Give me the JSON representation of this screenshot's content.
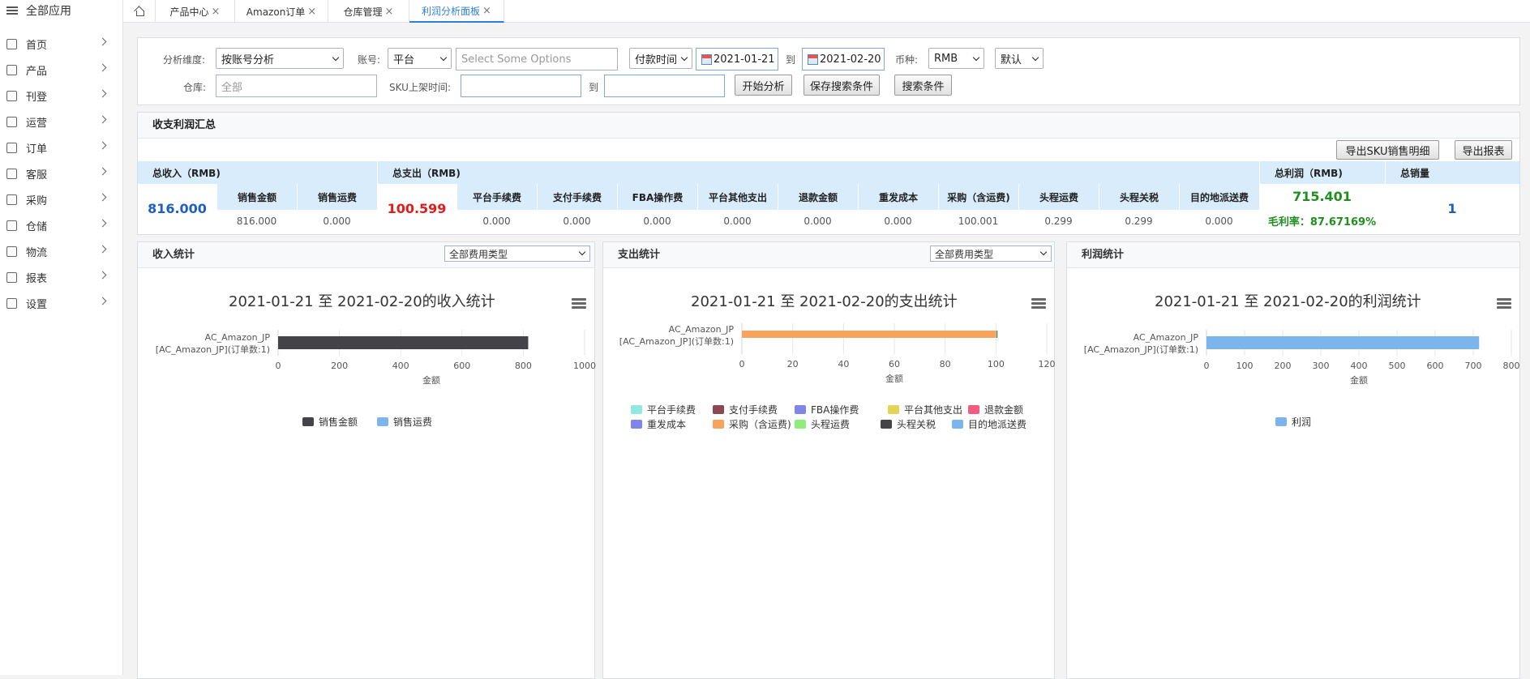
{
  "sidebar": {
    "header": "全部应用",
    "items": [
      {
        "label": "首页",
        "icon": "home-icon"
      },
      {
        "label": "产品",
        "icon": "box-icon"
      },
      {
        "label": "刊登",
        "icon": "publish-icon"
      },
      {
        "label": "运营",
        "icon": "chat-icon"
      },
      {
        "label": "订单",
        "icon": "document-icon"
      },
      {
        "label": "客服",
        "icon": "headset-icon"
      },
      {
        "label": "采购",
        "icon": "cart-icon"
      },
      {
        "label": "仓储",
        "icon": "warehouse-icon"
      },
      {
        "label": "物流",
        "icon": "truck-icon"
      },
      {
        "label": "报表",
        "icon": "report-icon"
      },
      {
        "label": "设置",
        "icon": "gear-icon"
      }
    ]
  },
  "tabs": [
    {
      "label": "产品中心"
    },
    {
      "label": "Amazon订单"
    },
    {
      "label": "仓库管理"
    },
    {
      "label": "利润分析面板",
      "active": true
    }
  ],
  "filter": {
    "dimension_label": "分析维度:",
    "dimension_value": "按账号分析",
    "account_label": "账号:",
    "account_value": "平台",
    "options_placeholder": "Select Some Options",
    "time_type": "付款时间",
    "date_from": "2021-01-21",
    "to_label": "到",
    "date_to": "2021-02-20",
    "currency_label": "币种:",
    "currency_value": "RMB",
    "default_value": "默认",
    "warehouse_label": "仓库:",
    "warehouse_placeholder": "全部",
    "sku_label": "SKU上架时间:",
    "to_label2": "到",
    "btn_start": "开始分析",
    "btn_save": "保存搜索条件",
    "btn_search": "搜索条件"
  },
  "summary": {
    "title": "收支利润汇总",
    "btn_export_sku": "导出SKU销售明细",
    "btn_export_report": "导出报表",
    "income_label": "总收入（RMB)",
    "income_total": "816.000",
    "income_cols": [
      {
        "label": "销售金额",
        "value": "816.000"
      },
      {
        "label": "销售运费",
        "value": "0.000"
      }
    ],
    "expense_label": "总支出（RMB)",
    "expense_total": "100.599",
    "expense_cols": [
      {
        "label": "平台手续费",
        "value": "0.000"
      },
      {
        "label": "支付手续费",
        "value": "0.000"
      },
      {
        "label": "FBA操作费",
        "value": "0.000"
      },
      {
        "label": "平台其他支出",
        "value": "0.000"
      },
      {
        "label": "退款金额",
        "value": "0.000"
      },
      {
        "label": "重发成本",
        "value": "0.000"
      },
      {
        "label": "采购（含运费)",
        "value": "100.001"
      },
      {
        "label": "头程运费",
        "value": "0.299"
      },
      {
        "label": "头程关税",
        "value": "0.299"
      },
      {
        "label": "目的地派送费",
        "value": "0.000"
      }
    ],
    "profit_label": "总利润（RMB)",
    "profit_total": "715.401",
    "margin_text": "毛利率：87.67169%",
    "sales_label": "总销量",
    "sales_total": "1"
  },
  "panels": [
    {
      "title": "收入统计",
      "select": "全部费用类型"
    },
    {
      "title": "支出统计",
      "select": "全部费用类型"
    },
    {
      "title": "利润统计"
    }
  ],
  "chart_data": [
    {
      "type": "bar",
      "orientation": "horizontal",
      "title": "2021-01-21 至 2021-02-20的收入统计",
      "categories": [
        "AC_Amazon_JP\n[AC_Amazon_JP](订单数:1)"
      ],
      "category_lines": [
        "AC_Amazon_JP",
        "[AC_Amazon_JP](订单数:1)"
      ],
      "series": [
        {
          "name": "销售金额",
          "values": [
            816
          ],
          "color": "#434348"
        },
        {
          "name": "销售运费",
          "values": [
            0
          ],
          "color": "#7cb5ec"
        }
      ],
      "xlabel": "金额",
      "xlim": [
        0,
        1000
      ],
      "ticks": [
        0,
        200,
        400,
        600,
        800,
        1000
      ],
      "stacked": true,
      "legend": "bottom-center"
    },
    {
      "type": "bar",
      "orientation": "horizontal",
      "title": "2021-01-21 至 2021-02-20的支出统计",
      "categories": [
        "AC_Amazon_JP\n[AC_Amazon_JP](订单数:1)"
      ],
      "category_lines": [
        "AC_Amazon_JP",
        "[AC_Amazon_JP](订单数:1)"
      ],
      "series": [
        {
          "name": "平台手续费",
          "values": [
            0
          ],
          "color": "#91e8e1"
        },
        {
          "name": "支付手续费",
          "values": [
            0
          ],
          "color": "#8d4653"
        },
        {
          "name": "FBA操作费",
          "values": [
            0
          ],
          "color": "#8085e8"
        },
        {
          "name": "平台其他支出",
          "values": [
            0
          ],
          "color": "#e4d354"
        },
        {
          "name": "退款金额",
          "values": [
            0
          ],
          "color": "#f15c80"
        },
        {
          "name": "重发成本",
          "values": [
            0
          ],
          "color": "#8085e9"
        },
        {
          "name": "采购（含运费)",
          "values": [
            100.001
          ],
          "color": "#f7a35c"
        },
        {
          "name": "头程运费",
          "values": [
            0.299
          ],
          "color": "#90ed7d"
        },
        {
          "name": "头程关税",
          "values": [
            0.299
          ],
          "color": "#434348"
        },
        {
          "name": "目的地派送费",
          "values": [
            0
          ],
          "color": "#7cb5ec"
        }
      ],
      "xlabel": "金额",
      "xlim": [
        0,
        120
      ],
      "ticks": [
        0,
        20,
        40,
        60,
        80,
        100,
        120
      ],
      "stacked": true,
      "legend": "bottom-center"
    },
    {
      "type": "bar",
      "orientation": "horizontal",
      "title": "2021-01-21 至 2021-02-20的利润统计",
      "categories": [
        "AC_Amazon_JP\n[AC_Amazon_JP](订单数:1)"
      ],
      "category_lines": [
        "AC_Amazon_JP",
        "[AC_Amazon_JP](订单数:1)"
      ],
      "series": [
        {
          "name": "利润",
          "values": [
            715.401
          ],
          "color": "#7cb5ec"
        }
      ],
      "xlabel": "金额",
      "xlim": [
        0,
        800
      ],
      "ticks": [
        0,
        100,
        200,
        300,
        400,
        500,
        600,
        700,
        800
      ],
      "stacked": true,
      "legend": "bottom-center"
    }
  ]
}
